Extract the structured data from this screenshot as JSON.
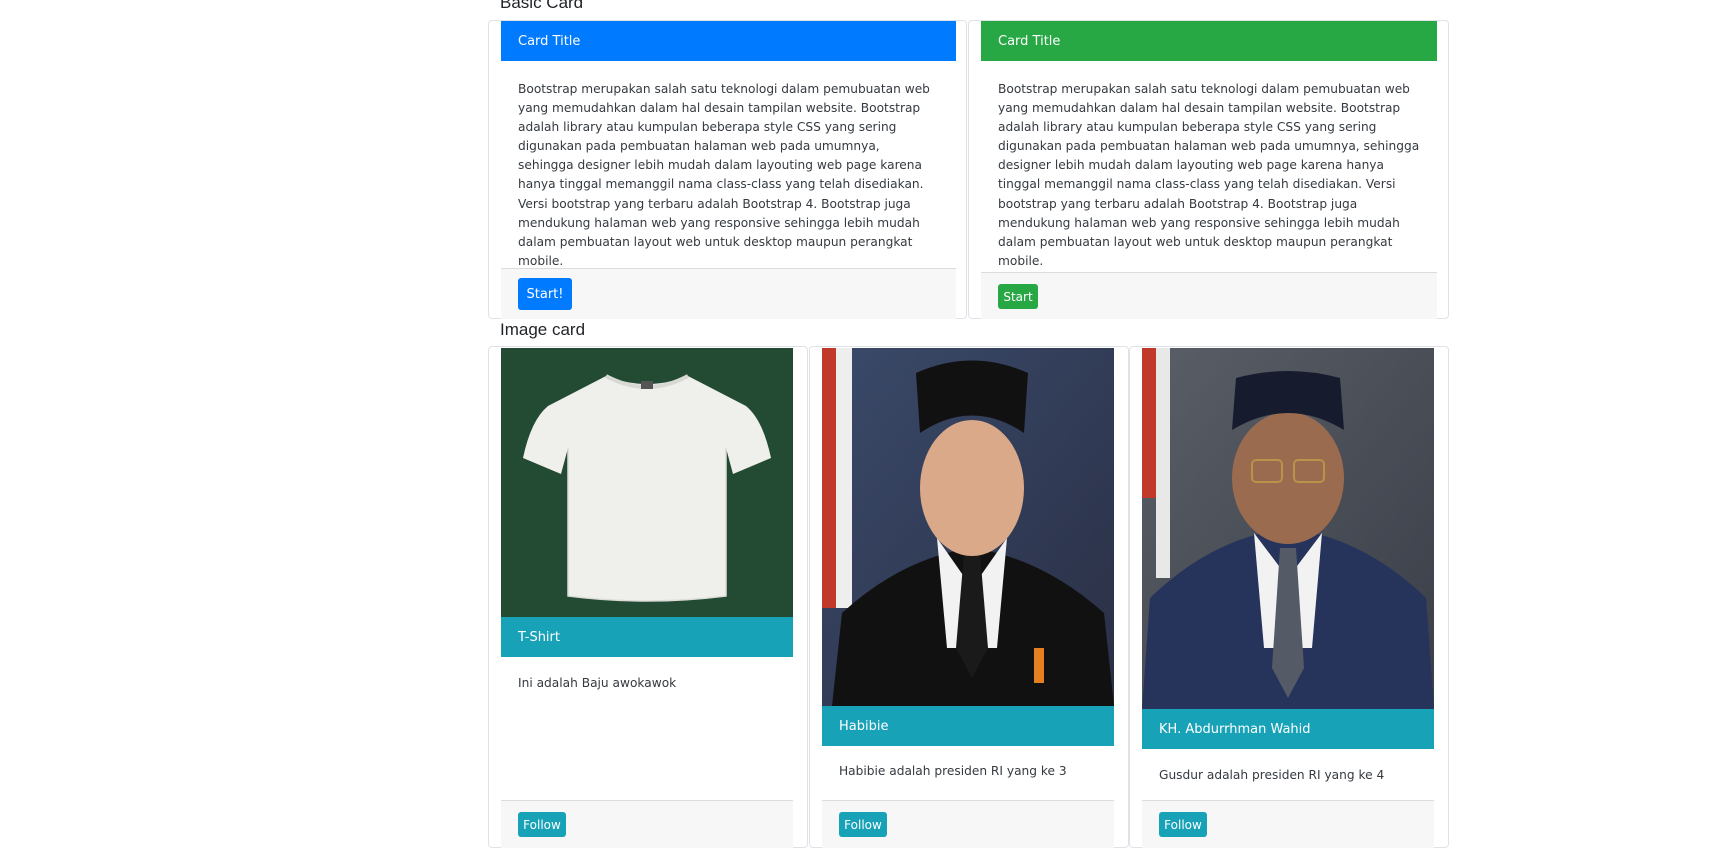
{
  "colors": {
    "primary": "#007bff",
    "success": "#28a745",
    "info": "#17a2b8",
    "footer_bg": "#f7f7f7",
    "tshirt_bg": "#234a33"
  },
  "basic_section": {
    "title": "Basic Card",
    "cards": [
      {
        "header": "Card Title",
        "body": "Bootstrap merupakan salah satu teknologi dalam pemubuatan web yang memudahkan dalam hal desain tampilan website. Bootstrap adalah library atau kumpulan beberapa style CSS yang sering digunakan pada pembuatan halaman web pada umumnya, sehingga designer lebih mudah dalam layouting web page karena hanya tinggal memanggil nama class-class yang telah disediakan. Versi bootstrap yang terbaru adalah Bootstrap 4. Bootstrap juga mendukung halaman web yang responsive sehingga lebih mudah dalam pembuatan layout web untuk desktop maupun perangkat mobile.",
        "button": "Start!"
      },
      {
        "header": "Card Title",
        "body": "Bootstrap merupakan salah satu teknologi dalam pemubuatan web yang memudahkan dalam hal desain tampilan website. Bootstrap adalah library atau kumpulan beberapa style CSS yang sering digunakan pada pembuatan halaman web pada umumnya, sehingga designer lebih mudah dalam layouting web page karena hanya tinggal memanggil nama class-class yang telah disediakan. Versi bootstrap yang terbaru adalah Bootstrap 4. Bootstrap juga mendukung halaman web yang responsive sehingga lebih mudah dalam pembuatan layout web untuk desktop maupun perangkat mobile.",
        "button": "Start"
      }
    ]
  },
  "image_section": {
    "title": "Image card",
    "cards": [
      {
        "image": "tshirt-image",
        "header": "T-Shirt",
        "body": "Ini adalah Baju awokawok",
        "button": "Follow"
      },
      {
        "image": "portrait-image",
        "header": "Habibie",
        "body": "Habibie adalah presiden RI yang ke 3",
        "button": "Follow"
      },
      {
        "image": "portrait-image",
        "header": "KH. Abdurrhman Wahid",
        "body": "Gusdur adalah presiden RI yang ke 4",
        "button": "Follow"
      }
    ]
  }
}
